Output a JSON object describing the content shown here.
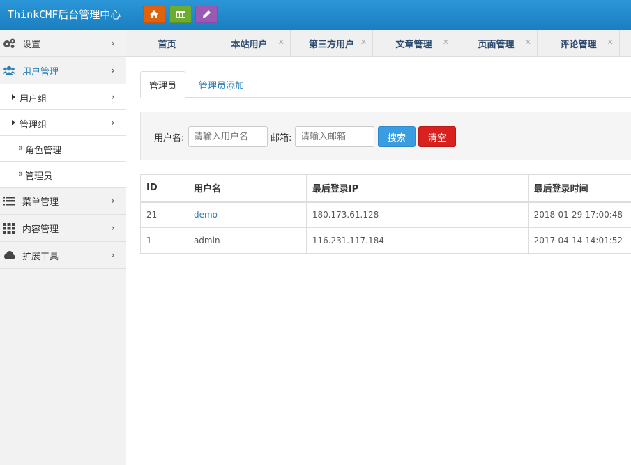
{
  "header": {
    "brand": "ThinkCMF后台管理中心",
    "buttons": [
      {
        "icon": "home-icon",
        "color": "#e2620c"
      },
      {
        "icon": "table-icon",
        "color": "#6cac2e"
      },
      {
        "icon": "pencil-icon",
        "color": "#9b59b6"
      }
    ]
  },
  "sidebar": {
    "items": [
      {
        "label": "设置",
        "icon": "gears-icon"
      },
      {
        "label": "用户管理",
        "icon": "users-icon"
      },
      {
        "label": "用户组"
      },
      {
        "label": "管理组"
      },
      {
        "label": "角色管理",
        "prefix": "»"
      },
      {
        "label": "管理员",
        "prefix": "»"
      },
      {
        "label": "菜单管理",
        "icon": "list-icon"
      },
      {
        "label": "内容管理",
        "icon": "grid-icon"
      },
      {
        "label": "扩展工具",
        "icon": "cloud-icon"
      }
    ]
  },
  "page_tabs": [
    "首页",
    "本站用户",
    "第三方用户",
    "文章管理",
    "页面管理",
    "评论管理"
  ],
  "content_tabs": {
    "active": "管理员",
    "other": "管理员添加"
  },
  "filter": {
    "username_label": "用户名:",
    "username_placeholder": "请输入用户名",
    "email_label": "邮箱:",
    "email_placeholder": "请输入邮箱",
    "search_label": "搜索",
    "clear_label": "清空"
  },
  "table": {
    "headers": [
      "ID",
      "用户名",
      "最后登录IP",
      "最后登录时间"
    ],
    "rows": [
      {
        "id": "21",
        "username": "demo",
        "ip": "180.173.61.128",
        "time": "2018-01-29 17:00:48"
      },
      {
        "id": "1",
        "username": "admin",
        "ip": "116.231.117.184",
        "time": "2017-04-14 14:01:52"
      }
    ]
  },
  "colors": {
    "header_blue": "#1e88c9",
    "link_blue": "#2a80b9",
    "search_blue": "#3a9de0",
    "clear_red": "#d9211f"
  }
}
